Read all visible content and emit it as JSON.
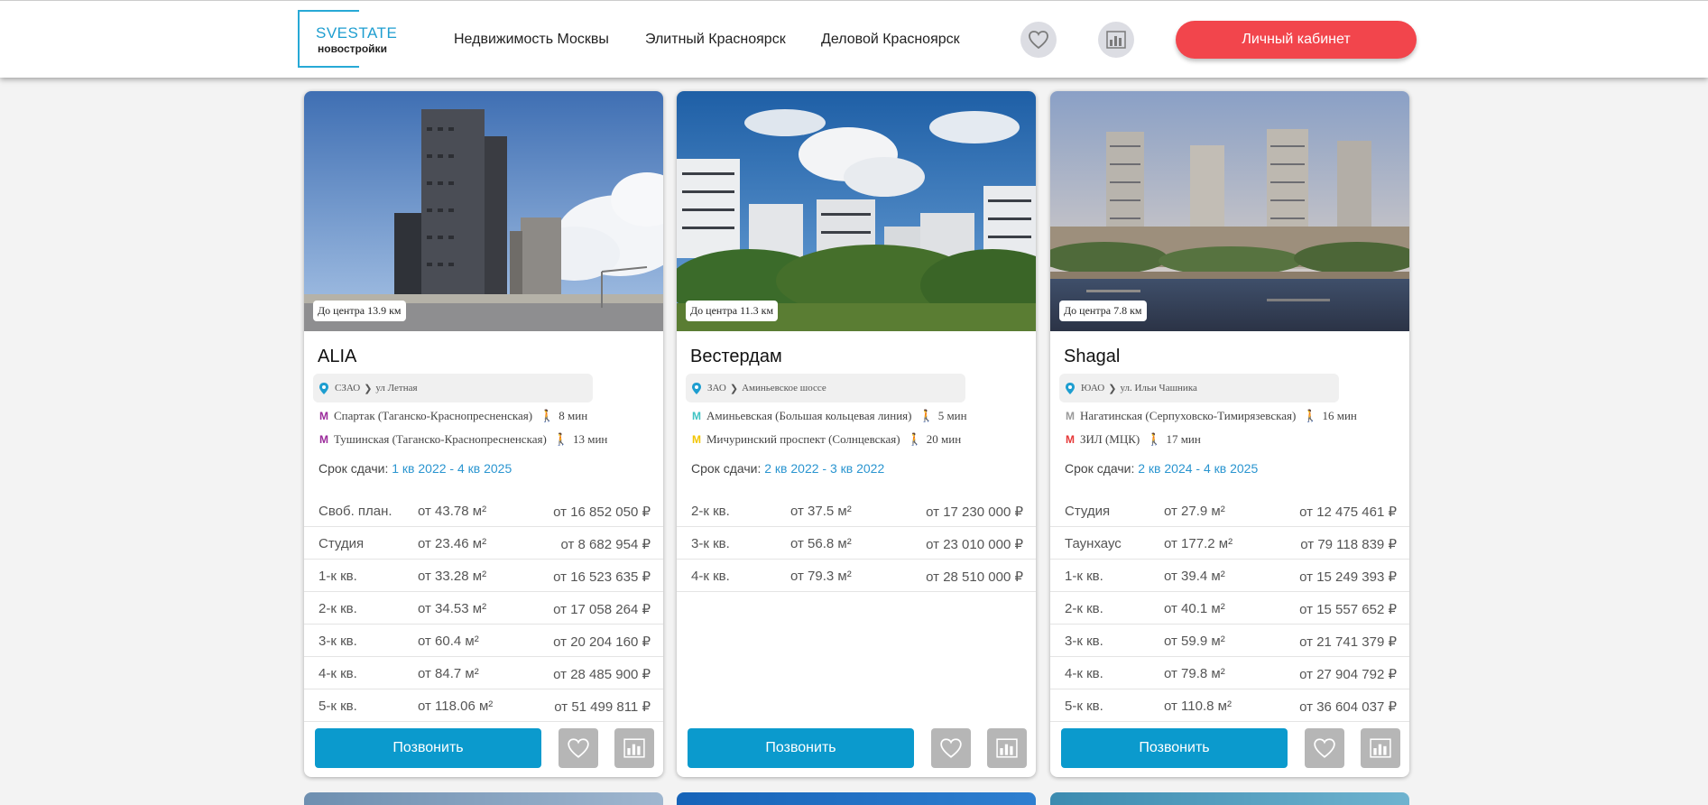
{
  "header": {
    "logo_brand": "SVESTATE",
    "logo_sub": "новостройки",
    "nav": [
      "Недвижимость Москвы",
      "Элитный Красноярск",
      "Деловой Красноярск"
    ],
    "cabinet_label": "Личный кабинет"
  },
  "cards": [
    {
      "distance": "До центра 13.9 км",
      "title": "ALIA",
      "district": "СЗАО",
      "street": "ул Летная",
      "metro": [
        {
          "name": "Спартак (Таганско-Краснопресненская)",
          "walk": "8 мин",
          "color": "#9b2a9b"
        },
        {
          "name": "Тушинская (Таганско-Краснопресненская)",
          "walk": "13 мин",
          "color": "#9b2a9b"
        }
      ],
      "deadline_label": "Срок сдачи:",
      "deadline": "1 кв 2022 - 4 кв 2025",
      "rows": [
        {
          "type": "Своб. план.",
          "area": "от 43.78 м²",
          "price": "от 16 852 050 ₽"
        },
        {
          "type": "Студия",
          "area": "от 23.46 м²",
          "price": "от 8 682 954 ₽"
        },
        {
          "type": "1-к кв.",
          "area": "от 33.28 м²",
          "price": "от 16 523 635 ₽"
        },
        {
          "type": "2-к кв.",
          "area": "от 34.53 м²",
          "price": "от 17 058 264 ₽"
        },
        {
          "type": "3-к кв.",
          "area": "от 60.4 м²",
          "price": "от 20 204 160 ₽"
        },
        {
          "type": "4-к кв.",
          "area": "от 84.7 м²",
          "price": "от 28 485 900 ₽"
        },
        {
          "type": "5-к кв.",
          "area": "от 118.06 м²",
          "price": "от 51 499 811 ₽"
        }
      ],
      "call_label": "Позвонить"
    },
    {
      "distance": "До центра 11.3 км",
      "title": "Вестердам",
      "district": "ЗАО",
      "street": "Аминьевское шоссе",
      "metro": [
        {
          "name": "Аминьевская (Большая кольцевая линия)",
          "walk": "5 мин",
          "color": "#3ec3c3"
        },
        {
          "name": "Мичуринский проспект (Солнцевская)",
          "walk": "20 мин",
          "color": "#f2c500"
        }
      ],
      "deadline_label": "Срок сдачи:",
      "deadline": "2 кв 2022 - 3 кв 2022",
      "rows": [
        {
          "type": "2-к кв.",
          "area": "от 37.5 м²",
          "price": "от 17 230 000 ₽"
        },
        {
          "type": "3-к кв.",
          "area": "от 56.8 м²",
          "price": "от 23 010 000 ₽"
        },
        {
          "type": "4-к кв.",
          "area": "от 79.3 м²",
          "price": "от 28 510 000 ₽"
        }
      ],
      "call_label": "Позвонить"
    },
    {
      "distance": "До центра 7.8 км",
      "title": "Shagal",
      "district": "ЮАО",
      "street": "ул. Ильи Чашника",
      "metro": [
        {
          "name": "Нагатинская (Серпуховско-Тимирязевская)",
          "walk": "16 мин",
          "color": "#9a9a9a"
        },
        {
          "name": "ЗИЛ (МЦК)",
          "walk": "17 мин",
          "color": "#e63838"
        }
      ],
      "deadline_label": "Срок сдачи:",
      "deadline": "2 кв 2024 - 4 кв 2025",
      "rows": [
        {
          "type": "Студия",
          "area": "от 27.9 м²",
          "price": "от 12 475 461 ₽"
        },
        {
          "type": "Таунхаус",
          "area": "от 177.2 м²",
          "price": "от 79 118 839 ₽"
        },
        {
          "type": "1-к кв.",
          "area": "от 39.4 м²",
          "price": "от 15 249 393 ₽"
        },
        {
          "type": "2-к кв.",
          "area": "от 40.1 м²",
          "price": "от 15 557 652 ₽"
        },
        {
          "type": "3-к кв.",
          "area": "от 59.9 м²",
          "price": "от 21 741 379 ₽"
        },
        {
          "type": "4-к кв.",
          "area": "от 79.8 м²",
          "price": "от 27 904 792 ₽"
        },
        {
          "type": "5-к кв.",
          "area": "от 110.8 м²",
          "price": "от 36 604 037 ₽"
        }
      ],
      "call_label": "Позвонить"
    }
  ],
  "icons": {
    "favorite": "heart-icon",
    "compare": "bar-chart-icon",
    "location": "location-pin-icon",
    "metro": "metro-icon",
    "walk": "walking-person-icon"
  },
  "colors": {
    "accent": "#0b9acd",
    "cabinet": "#f2454c",
    "deadline": "#2a95d0"
  }
}
